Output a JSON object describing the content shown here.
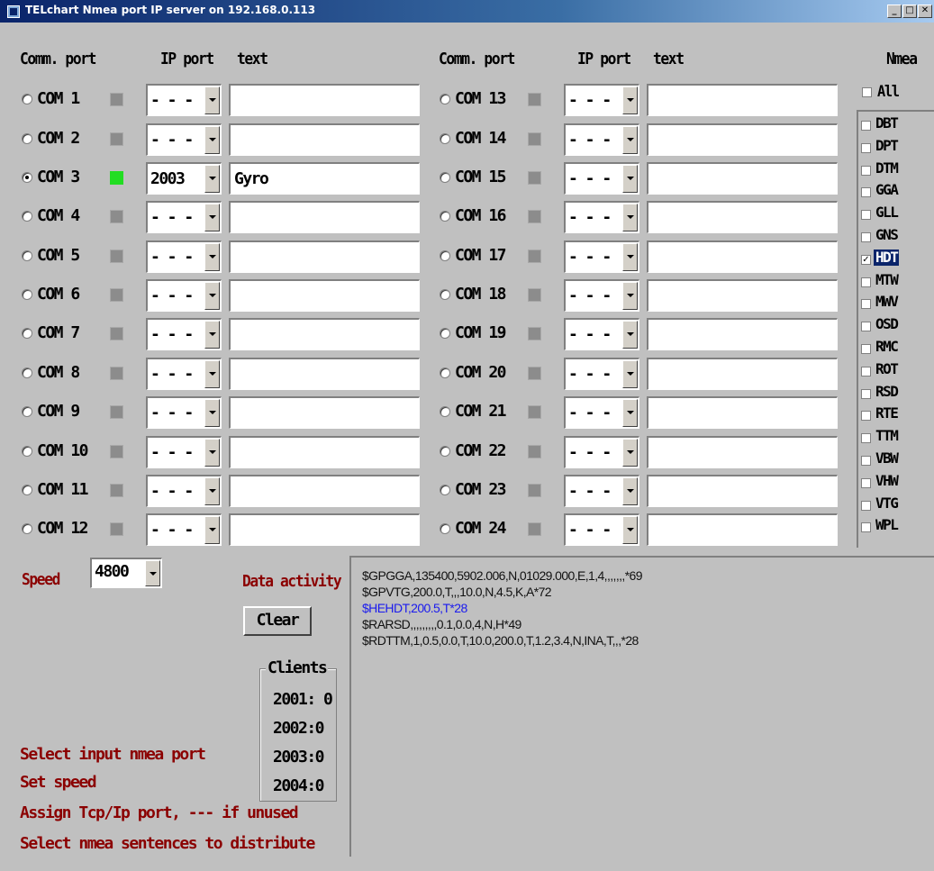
{
  "window": {
    "title": "TELchart Nmea port IP server on 192.168.0.113",
    "controls": {
      "minimize": "_",
      "maximize": "□",
      "close": "✕"
    }
  },
  "headers": {
    "comm_port": "Comm. port",
    "ip_port": "IP port",
    "text": "text",
    "nmea": "Nmea"
  },
  "ports_left": [
    {
      "label": "COM 1",
      "selected": false,
      "active": false,
      "ip": "- - -",
      "text": ""
    },
    {
      "label": "COM 2",
      "selected": false,
      "active": false,
      "ip": "- - -",
      "text": ""
    },
    {
      "label": "COM 3",
      "selected": true,
      "active": true,
      "ip": "2003",
      "text": "Gyro"
    },
    {
      "label": "COM 4",
      "selected": false,
      "active": false,
      "ip": "- - -",
      "text": ""
    },
    {
      "label": "COM 5",
      "selected": false,
      "active": false,
      "ip": "- - -",
      "text": ""
    },
    {
      "label": "COM 6",
      "selected": false,
      "active": false,
      "ip": "- - -",
      "text": ""
    },
    {
      "label": "COM 7",
      "selected": false,
      "active": false,
      "ip": "- - -",
      "text": ""
    },
    {
      "label": "COM 8",
      "selected": false,
      "active": false,
      "ip": "- - -",
      "text": ""
    },
    {
      "label": "COM 9",
      "selected": false,
      "active": false,
      "ip": "- - -",
      "text": ""
    },
    {
      "label": "COM 10",
      "selected": false,
      "active": false,
      "ip": "- - -",
      "text": ""
    },
    {
      "label": "COM 11",
      "selected": false,
      "active": false,
      "ip": "- - -",
      "text": ""
    },
    {
      "label": "COM 12",
      "selected": false,
      "active": false,
      "ip": "- - -",
      "text": ""
    }
  ],
  "ports_right": [
    {
      "label": "COM 13",
      "selected": false,
      "active": false,
      "ip": "- - -",
      "text": ""
    },
    {
      "label": "COM 14",
      "selected": false,
      "active": false,
      "ip": "- - -",
      "text": ""
    },
    {
      "label": "COM 15",
      "selected": false,
      "active": false,
      "ip": "- - -",
      "text": ""
    },
    {
      "label": "COM 16",
      "selected": false,
      "active": false,
      "ip": "- - -",
      "text": ""
    },
    {
      "label": "COM 17",
      "selected": false,
      "active": false,
      "ip": "- - -",
      "text": ""
    },
    {
      "label": "COM 18",
      "selected": false,
      "active": false,
      "ip": "- - -",
      "text": ""
    },
    {
      "label": "COM 19",
      "selected": false,
      "active": false,
      "ip": "- - -",
      "text": ""
    },
    {
      "label": "COM 20",
      "selected": false,
      "active": false,
      "ip": "- - -",
      "text": ""
    },
    {
      "label": "COM 21",
      "selected": false,
      "active": false,
      "ip": "- - -",
      "text": ""
    },
    {
      "label": "COM 22",
      "selected": false,
      "active": false,
      "ip": "- - -",
      "text": ""
    },
    {
      "label": "COM 23",
      "selected": false,
      "active": false,
      "ip": "- - -",
      "text": ""
    },
    {
      "label": "COM 24",
      "selected": false,
      "active": false,
      "ip": "- - -",
      "text": ""
    }
  ],
  "nmea": {
    "all_label": "All",
    "all_checked": false,
    "sentences": [
      {
        "name": "DBT",
        "checked": false
      },
      {
        "name": "DPT",
        "checked": false
      },
      {
        "name": "DTM",
        "checked": false
      },
      {
        "name": "GGA",
        "checked": false
      },
      {
        "name": "GLL",
        "checked": false
      },
      {
        "name": "GNS",
        "checked": false
      },
      {
        "name": "HDT",
        "checked": true
      },
      {
        "name": "MTW",
        "checked": false
      },
      {
        "name": "MWV",
        "checked": false
      },
      {
        "name": "OSD",
        "checked": false
      },
      {
        "name": "RMC",
        "checked": false
      },
      {
        "name": "ROT",
        "checked": false
      },
      {
        "name": "RSD",
        "checked": false
      },
      {
        "name": "RTE",
        "checked": false
      },
      {
        "name": "TTM",
        "checked": false
      },
      {
        "name": "VBW",
        "checked": false
      },
      {
        "name": "VHW",
        "checked": false
      },
      {
        "name": "VTG",
        "checked": false
      },
      {
        "name": "WPL",
        "checked": false
      }
    ]
  },
  "speed": {
    "label": "Speed",
    "value": "4800"
  },
  "data_activity": {
    "label": "Data activity",
    "clear_label": "Clear",
    "lines": [
      {
        "text": "$GPGGA,135400,5902.006,N,01029.000,E,1,4,,,,,,,*69",
        "highlight": false
      },
      {
        "text": "$GPVTG,200.0,T,,,10.0,N,4.5,K,A*72",
        "highlight": false
      },
      {
        "text": "$HEHDT,200.5,T*28",
        "highlight": true
      },
      {
        "text": "$RARSD,,,,,,,,,0.1,0.0,4,N,H*49",
        "highlight": false
      },
      {
        "text": "$RDTTM,1,0.5,0.0,T,10.0,200.0,T,1.2,3.4,N,INA,T,,,*28",
        "highlight": false
      }
    ]
  },
  "clients": {
    "title": "Clients",
    "items": [
      "2001: 0",
      "2002:0",
      "2003:0",
      "2004:0"
    ]
  },
  "instructions": [
    "Select input nmea port",
    "Set speed",
    "Assign Tcp/Ip port, --- if unused",
    "Select nmea sentences to distribute"
  ],
  "colors": {
    "active_led": "#22dd22",
    "label_red": "#8b0000",
    "highlight_blue": "#1a1aee",
    "selection": "#0a246a"
  }
}
